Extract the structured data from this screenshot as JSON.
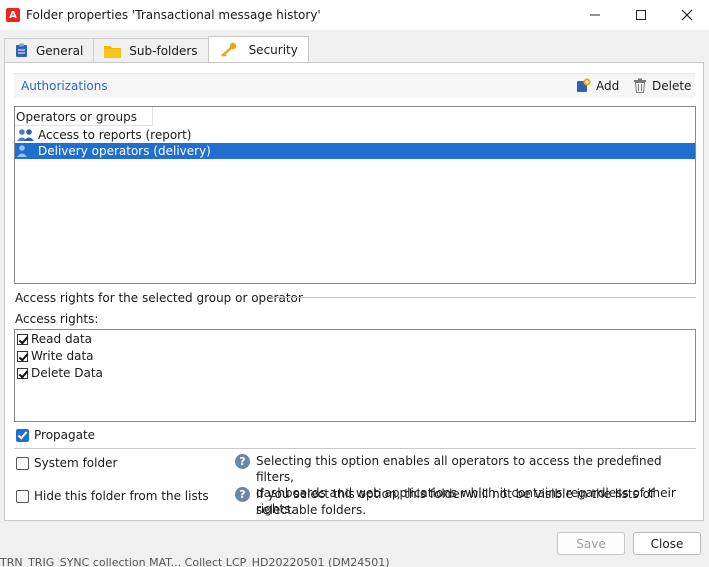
{
  "window": {
    "title": "Folder properties 'Transactional message history'",
    "logo_letter": "A"
  },
  "tabs": [
    {
      "label": "General",
      "icon": "clipboard-icon"
    },
    {
      "label": "Sub-folders",
      "icon": "folder-icon"
    },
    {
      "label": "Security",
      "icon": "key-icon"
    }
  ],
  "authorizations": {
    "title": "Authorizations",
    "add_label": "Add",
    "delete_label": "Delete",
    "column_header": "Operators or groups",
    "items": [
      {
        "label": "Access to reports (report)",
        "selected": false
      },
      {
        "label": "Delivery operators (delivery)",
        "selected": true
      }
    ]
  },
  "access": {
    "section_label": "Access rights for the selected group or operator",
    "rights_label": "Access rights:",
    "rights": [
      {
        "label": "Read data",
        "checked": true
      },
      {
        "label": "Write data",
        "checked": true
      },
      {
        "label": "Delete Data",
        "checked": true
      }
    ]
  },
  "options": {
    "propagate_label": "Propagate",
    "system_folder_label": "System folder",
    "system_folder_help_line1": "Selecting this option enables all operators to access the predefined filters,",
    "system_folder_help_line2": "dashboards and web applications which it contains regardless of their rights.",
    "hide_folder_label": "Hide this folder from the lists",
    "hide_folder_help": "If you select this option, this folder will not be visible in the lists of selectable folders."
  },
  "buttons": {
    "save_label": "Save",
    "close_label": "Close"
  },
  "background_text": "TRN_TRIG_SYNC collection MAT... Collect LCP_HD20220501 (DM24501)",
  "colors": {
    "accent": "#1f6fd0",
    "link": "#2b6cb4",
    "logo": "#e8261c"
  }
}
